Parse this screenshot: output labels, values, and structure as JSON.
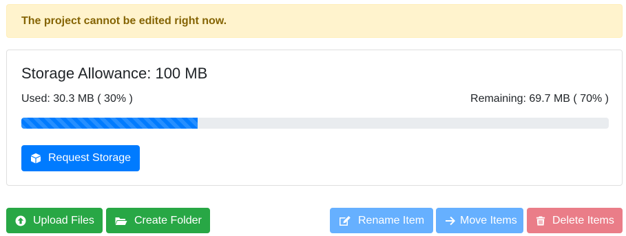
{
  "alert": {
    "message": "The project cannot be edited right now."
  },
  "storage": {
    "title": "Storage Allowance: 100 MB",
    "used_text": "Used: 30.3 MB ( 30% )",
    "remaining_text": "Remaining: 69.7 MB ( 70% )",
    "used_fraction": 0.3,
    "request_button_label": "Request Storage",
    "request_button_icon": "box-icon"
  },
  "actions": {
    "upload_label": "Upload Files",
    "upload_icon": "arrow-circle-up-icon",
    "create_folder_label": "Create Folder",
    "create_folder_icon": "folder-open-icon",
    "rename_label": "Rename Item",
    "rename_icon": "edit-icon",
    "move_label": "Move Items",
    "move_icon": "arrow-right-icon",
    "delete_label": "Delete Items",
    "delete_icon": "trash-icon"
  },
  "colors": {
    "alert_bg": "#fff3cd",
    "alert_text": "#856404",
    "primary": "#007bff",
    "success": "#28a745",
    "primary_disabled": "#66b0ff",
    "danger_disabled": "#ea7d88"
  }
}
